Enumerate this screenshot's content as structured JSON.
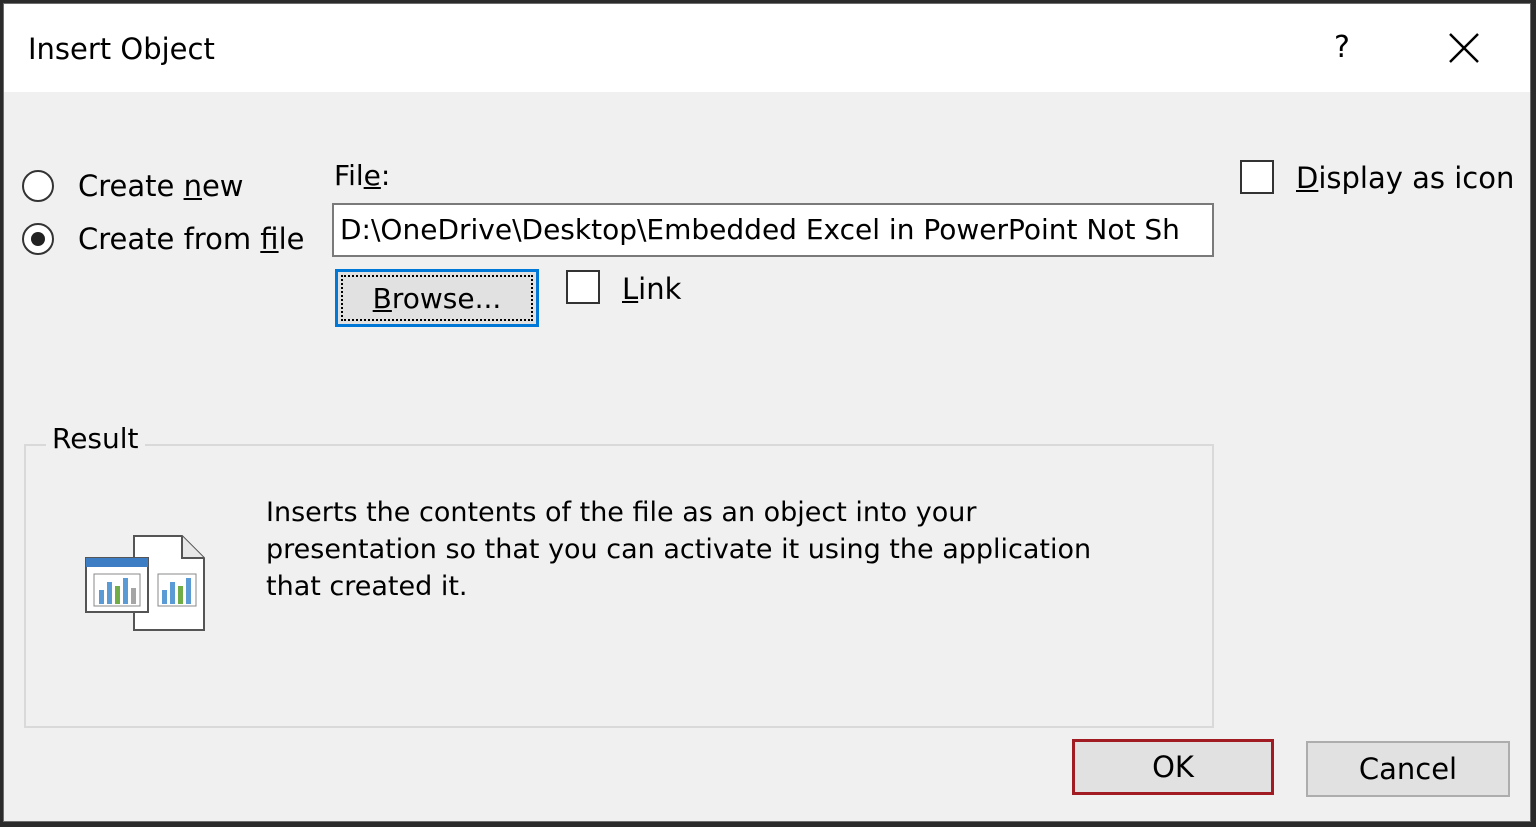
{
  "dialog": {
    "title": "Insert Object",
    "help_label": "?"
  },
  "options": {
    "create_new": {
      "pre": "Create ",
      "accel": "n",
      "post": "ew",
      "checked": false
    },
    "create_from_file": {
      "pre": "Create from ",
      "accel": "f",
      "post": "ile",
      "checked": true
    }
  },
  "file": {
    "label_pre": "Fil",
    "label_accel": "e",
    "label_post": ":",
    "value": "D:\\OneDrive\\Desktop\\Embedded Excel in PowerPoint Not Sh"
  },
  "browse": {
    "accel": "B",
    "post": "rowse..."
  },
  "link": {
    "accel": "L",
    "post": "ink",
    "checked": false
  },
  "display_as_icon": {
    "accel": "D",
    "post": "isplay as icon",
    "checked": false
  },
  "result": {
    "label": "Result",
    "lines": [
      "Inserts the contents of the file as an object into your",
      "presentation so that you can activate it using the application",
      "that created it."
    ]
  },
  "buttons": {
    "ok": "OK",
    "cancel": "Cancel"
  },
  "icon_names": {
    "help": "help-icon",
    "close": "close-icon",
    "result": "embedded-object-icon"
  }
}
